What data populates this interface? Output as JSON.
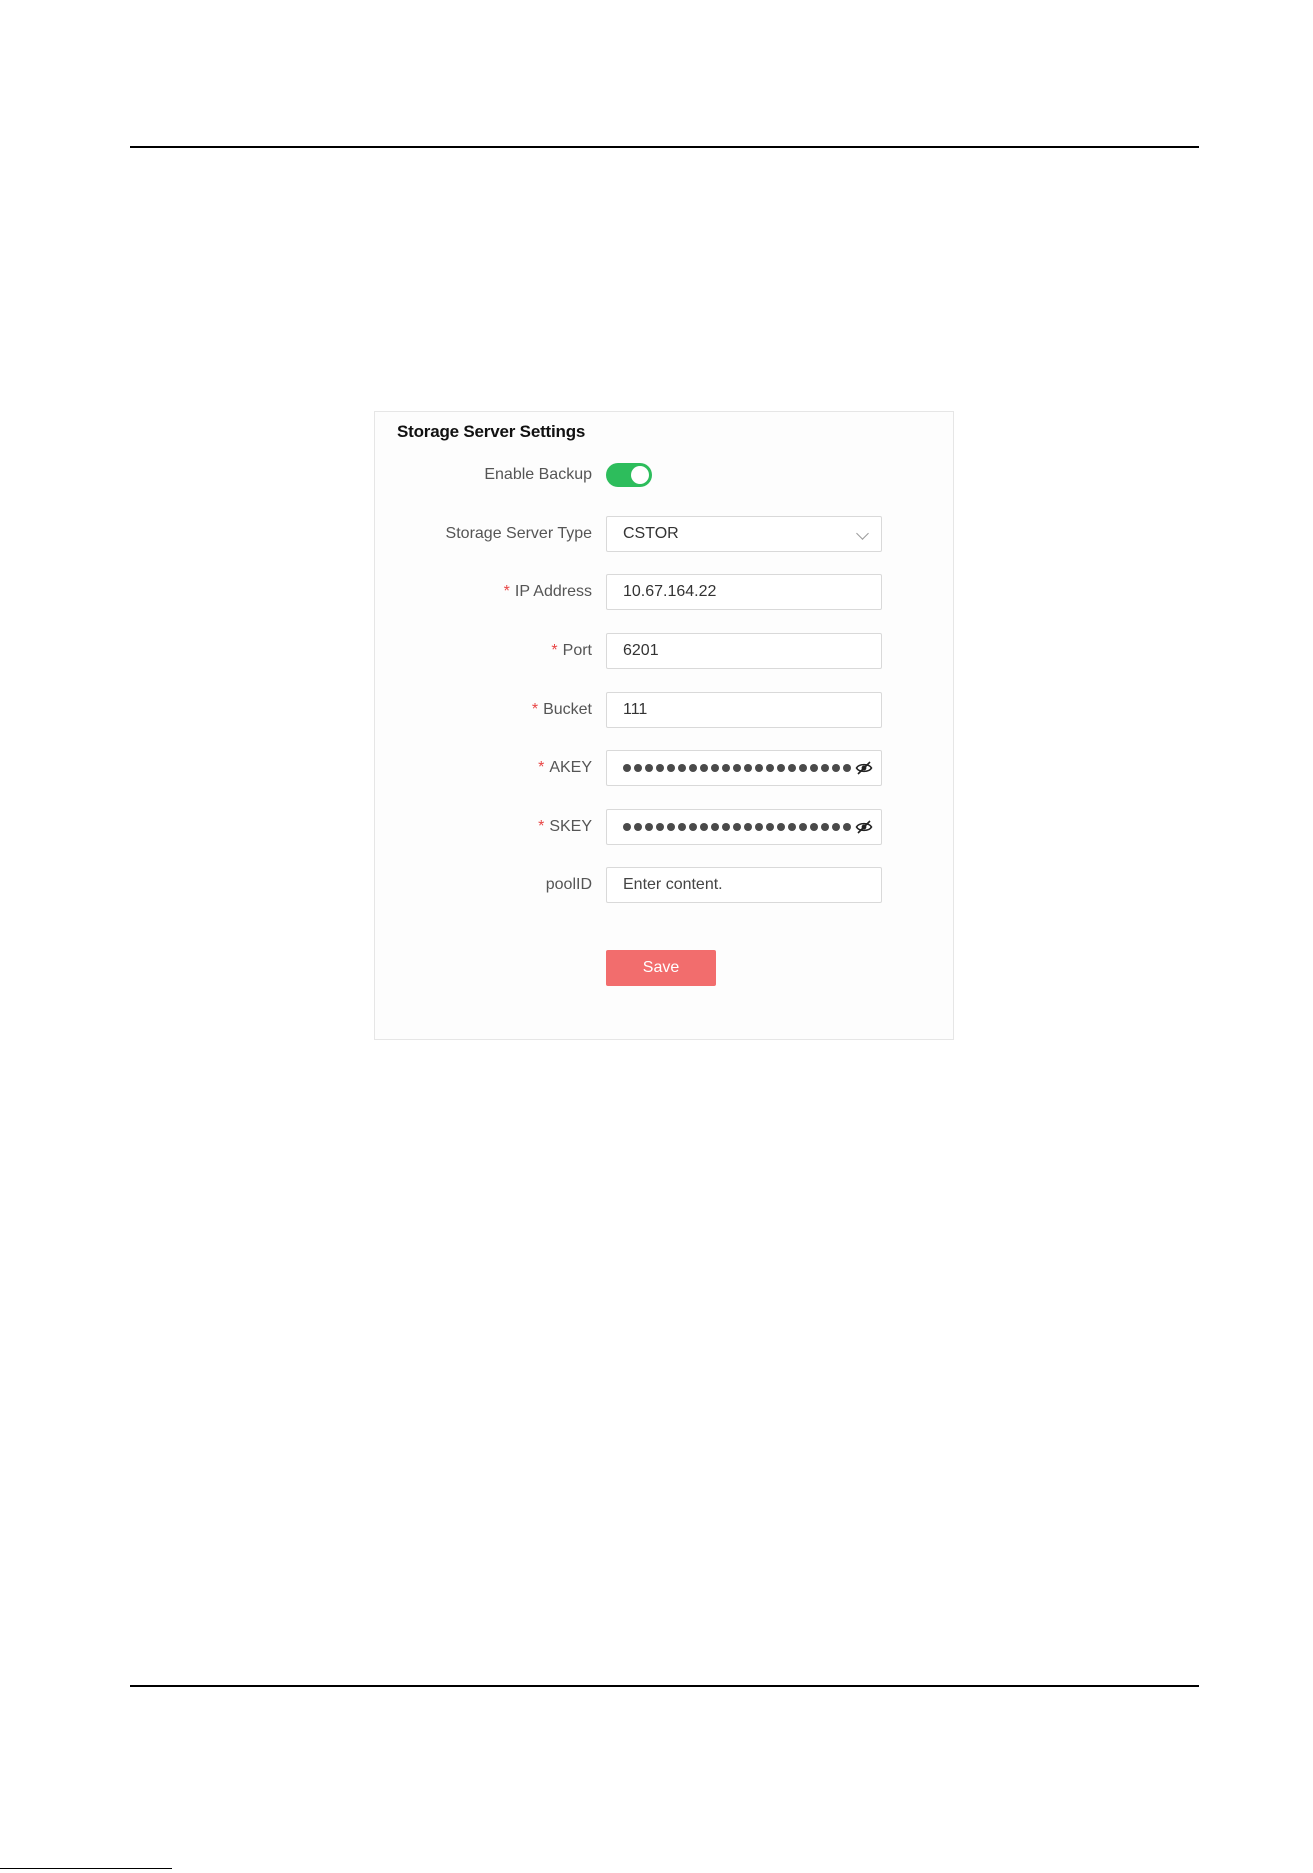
{
  "panel": {
    "title": "Storage Server Settings"
  },
  "form": {
    "enable_backup": {
      "label": "Enable Backup",
      "enabled": true,
      "accent_color": "#2dbd5c"
    },
    "storage_server_type": {
      "label": "Storage Server Type",
      "value": "CSTOR"
    },
    "ip_address": {
      "required": "*",
      "label": "IP Address",
      "value": "10.67.164.22"
    },
    "port": {
      "required": "*",
      "label": "Port",
      "value": "6201"
    },
    "bucket": {
      "required": "*",
      "label": "Bucket",
      "value": "111"
    },
    "akey": {
      "required": "*",
      "label": "AKEY",
      "masked_length": 21,
      "icon": "eye-slash-icon"
    },
    "skey": {
      "required": "*",
      "label": "SKEY",
      "masked_length": 21,
      "icon": "eye-slash-icon"
    },
    "pool_id": {
      "label": "poolID",
      "placeholder": "Enter content."
    }
  },
  "actions": {
    "save_label": "Save",
    "save_color": "#f26d6d"
  }
}
